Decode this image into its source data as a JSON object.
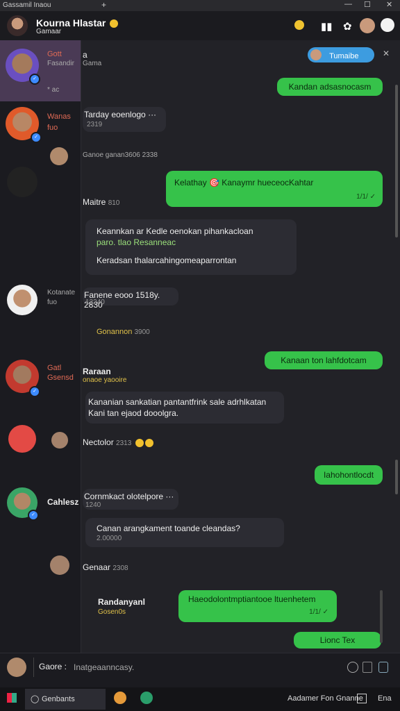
{
  "window": {
    "tab_title": "Gassamil Inaou",
    "new_tab": "+",
    "min": "—",
    "max": "☐",
    "close": "✕"
  },
  "header": {
    "title": "Kourna Hlastar",
    "subtitle": "Gamaar",
    "icons": [
      "notification-icon",
      "pin-icon",
      "settings-icon"
    ]
  },
  "sidebar": {
    "items": [
      {
        "name": "Gott",
        "sub": "Fasandir",
        "preview": "* ac"
      },
      {
        "name": "Wanas",
        "sub": "fuo",
        "preview": ""
      },
      {
        "name": "",
        "sub": "",
        "preview": ""
      },
      {
        "name": "Kotanate",
        "sub": "fuo",
        "preview": ""
      },
      {
        "name": "Gatl",
        "sub": "Gsensd",
        "preview": ""
      },
      {
        "name": "",
        "sub": "",
        "preview": ""
      },
      {
        "name": "Cahlesz",
        "sub": "",
        "preview": ""
      }
    ]
  },
  "chat": {
    "top_sender": "a",
    "top_sender_sub": "Gama",
    "badge": "Tumaibe",
    "messages": [
      {
        "dir": "out",
        "text": "Kandan adsasnocasm"
      },
      {
        "dir": "in",
        "text": "Tarday eoenlogo ···",
        "time": "2319"
      },
      {
        "dir": "in_small",
        "text": "Ganoe ganan3606",
        "time": "2338"
      },
      {
        "dir": "out",
        "text": "Kelathay 🎯 Kanaymr hueceocKahtar",
        "time": "1/1/ ✓"
      },
      {
        "dir": "label",
        "text": "Maitre",
        "time": "810"
      },
      {
        "dir": "in",
        "text": "Keannkan ar Kedle oenokan pihankacloan",
        "line2": "paro. tlao Resanneac",
        "line3": "Keradsan thalarcahingomeaparrontan"
      },
      {
        "dir": "in",
        "text": "Fanene eooo 1518y. 2830",
        "time": "13240"
      },
      {
        "dir": "label",
        "text": "Gonannon",
        "time": "3900"
      },
      {
        "dir": "out",
        "text": "Kanaan ton lahfdotcam"
      },
      {
        "dir": "label",
        "text": "Raraan",
        "sub": "onaoe yaooire"
      },
      {
        "dir": "in",
        "text": "Kananian sankatian pantantfrink sale adrhlkatan",
        "line2": "Kani tan ejaod dooolgra."
      },
      {
        "dir": "label",
        "text": "Nectolor",
        "time": "2313"
      },
      {
        "dir": "out",
        "text": "Iahohontlocdt"
      },
      {
        "dir": "in",
        "text": "Cornmkact olotelpore ···",
        "time": "1240"
      },
      {
        "dir": "in",
        "text": "Canan arangkament toande cleandas?",
        "time": "2.00000"
      },
      {
        "dir": "label",
        "text": "Genaar",
        "time": "2308"
      },
      {
        "dir": "label",
        "text": "Randanyanl",
        "sub": "Gosen0s"
      },
      {
        "dir": "out",
        "text": "Haeodolontmptiantooe ltuenhetem",
        "time": "1/1/ ✓"
      },
      {
        "dir": "out",
        "text": "Lionc Tex"
      }
    ]
  },
  "composer": {
    "label": "Gaore :",
    "placeholder": "Inatgeaanncasy."
  },
  "taskbar": {
    "search": "Genbants",
    "right_text": "Aadamer Fon Gnanne",
    "right2": "Ena"
  },
  "colors": {
    "accent_green": "#36c24a",
    "badge_blue": "#3d8bff",
    "name_red": "#e06a55"
  }
}
